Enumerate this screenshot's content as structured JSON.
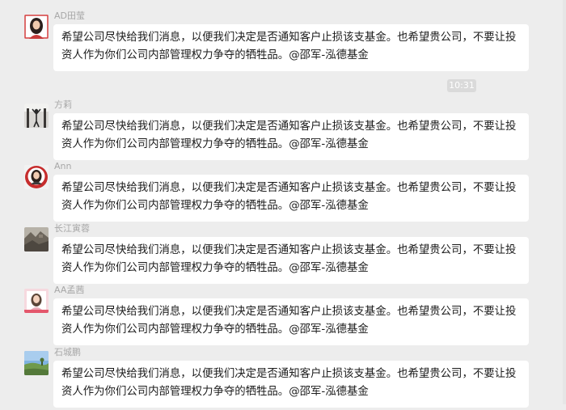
{
  "time_badge": "10:31",
  "messages": [
    {
      "sender": "AD田莹",
      "avatar_icon": "woman-portrait-avatar",
      "text": "希望公司尽快给我们消息，以便我们决定是否通知客户止损该支基金。也希望贵公司，不要让投资人作为你们公司内部管理权力争夺的牺牲品。@邵军-泓德基金"
    },
    {
      "sender": "方莉",
      "avatar_icon": "dancer-photo-avatar",
      "text": "希望公司尽快给我们消息，以便我们决定是否通知客户止损该支基金。也希望贵公司，不要让投资人作为你们公司内部管理权力争夺的牺牲品。@邵军-泓德基金"
    },
    {
      "sender": "Ann",
      "avatar_icon": "woman-circle-badge-avatar",
      "text": "希望公司尽快给我们消息，以便我们决定是否通知客户止损该支基金。也希望贵公司，不要让投资人作为你们公司内部管理权力争夺的牺牲品。@邵军-泓德基金"
    },
    {
      "sender": "长江寅蓉",
      "avatar_icon": "landscape-photo-avatar",
      "text": "希望公司尽快给我们消息，以便我们决定是否通知客户止损该支基金。也希望贵公司，不要让投资人作为你们公司内部管理权力争夺的牺牲品。@邵军-泓德基金"
    },
    {
      "sender": "AA孟茜",
      "avatar_icon": "woman-pink-frame-avatar",
      "text": "希望公司尽快给我们消息，以便我们决定是否通知客户止损该支基金。也希望贵公司，不要让投资人作为你们公司内部管理权力争夺的牺牲品。@邵军-泓德基金"
    },
    {
      "sender": "石城鹏",
      "avatar_icon": "sky-field-photo-avatar",
      "text": "希望公司尽快给我们消息，以便我们决定是否通知客户止损该支基金。也希望贵公司，不要让投资人作为你们公司内部管理权力争夺的牺牲品。@邵军-泓德基金"
    }
  ]
}
